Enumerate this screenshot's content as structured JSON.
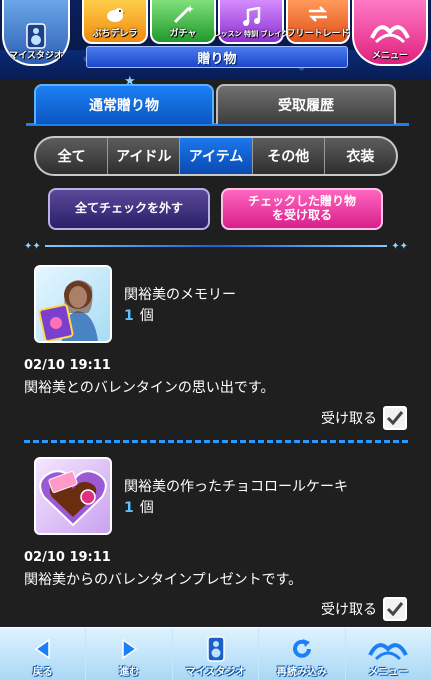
{
  "topnav": {
    "mystudio_label": "マイスタジオ",
    "puchi_label": "ぷちデレラ",
    "gacha_label": "ガチャ",
    "lesson_label": "レッスン 特訓 ブレイク",
    "trade_label": "フリートレード",
    "menu_label": "メニュー",
    "page_title": "贈り物"
  },
  "tabs": [
    {
      "label": "通常贈り物",
      "active": true
    },
    {
      "label": "受取履歴",
      "active": false
    }
  ],
  "filters": [
    {
      "label": "全て",
      "active": false
    },
    {
      "label": "アイドル",
      "active": false
    },
    {
      "label": "アイテム",
      "active": true
    },
    {
      "label": "その他",
      "active": false
    },
    {
      "label": "衣装",
      "active": false
    }
  ],
  "actions": {
    "uncheck_all": "全てチェックを外す",
    "receive_checked_line1": "チェックした贈り物",
    "receive_checked_line2": "を受け取る"
  },
  "gifts": [
    {
      "name": "関裕美のメモリー",
      "qty": "1",
      "qty_unit": "個",
      "date": "02/10 19:11",
      "description": "関裕美とのバレンタインの思い出です。",
      "receive_label": "受け取る",
      "checked": true,
      "thumb_icon": "memory-card-icon"
    },
    {
      "name": "関裕美の作ったチョコロールケーキ",
      "qty": "1",
      "qty_unit": "個",
      "date": "02/10 19:11",
      "description": "関裕美からのバレンタインプレゼントです。",
      "receive_label": "受け取る",
      "checked": true,
      "thumb_icon": "chocolate-box-icon"
    }
  ],
  "bottomnav": [
    {
      "label": "戻る",
      "icon": "back-arrow-icon"
    },
    {
      "label": "進む",
      "icon": "forward-arrow-icon"
    },
    {
      "label": "マイスタジオ",
      "icon": "mystudio-icon"
    },
    {
      "label": "再読み込み",
      "icon": "reload-icon"
    },
    {
      "label": "メニュー",
      "icon": "menu-icon"
    }
  ],
  "colors": {
    "active_blue": "#1b7ff5",
    "pink_button": "#ff66bf",
    "qty_blue": "#5ec0ff",
    "divider_blue": "#2a9cff"
  }
}
